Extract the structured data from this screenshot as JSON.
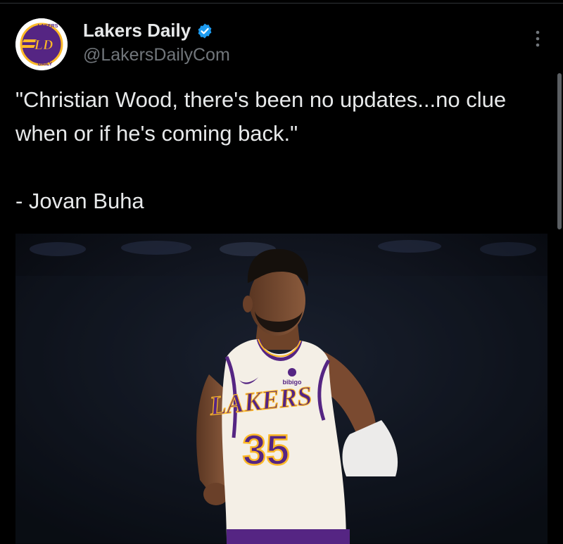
{
  "account": {
    "display_name": "Lakers Daily",
    "handle": "@LakersDailyCom",
    "avatar_logo_text": "LD",
    "avatar_ring_text_top": "LAKERS",
    "avatar_ring_text_bottom": "DAILY",
    "verified_color": "#1d9bf0"
  },
  "tweet": {
    "text": "\"Christian Wood, there's been no updates...no clue when or if he's coming back.\"\n\n- Jovan Buha"
  },
  "media": {
    "jersey_team": "LAKERS",
    "jersey_number": "35",
    "jersey_sponsor": "bibigo",
    "jersey_color": "#f4efe6",
    "accent_purple": "#552583",
    "accent_gold": "#fdb927"
  },
  "icons": {
    "more": "more-vertical-icon",
    "verified": "verified-badge-icon"
  }
}
